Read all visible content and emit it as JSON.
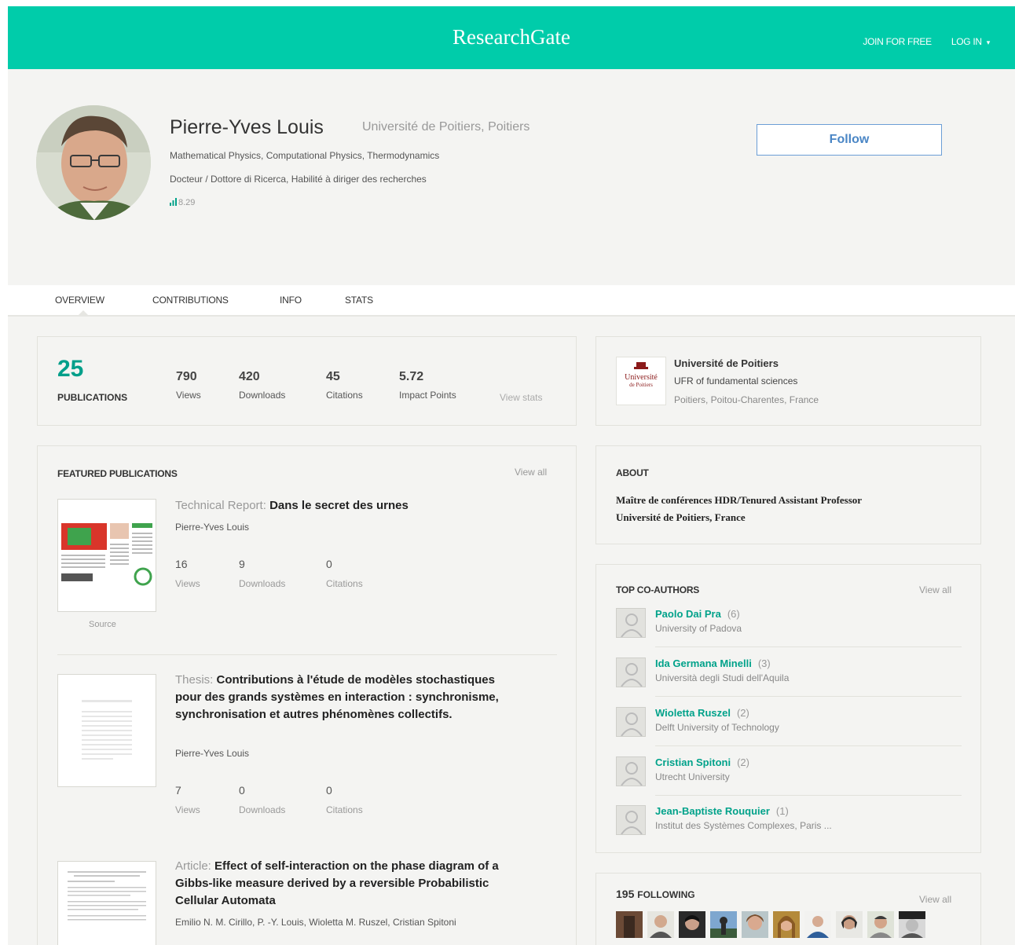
{
  "header": {
    "brand": "ResearchGate",
    "join_label": "JOIN FOR FREE",
    "login_label": "LOG IN",
    "login_caret": "▾",
    "color_accent": "#00ccaa"
  },
  "profile": {
    "name": "Pierre-Yves Louis",
    "institution": "Université de Poitiers, Poitiers",
    "topics": "Mathematical Physics, Computational Physics, Thermodynamics",
    "degree": "Docteur / Dottore di Ricerca, Habilité à diriger des recherches",
    "score": "8.29",
    "follow_label": "Follow"
  },
  "tabs": [
    "OVERVIEW",
    "CONTRIBUTIONS",
    "INFO",
    "STATS"
  ],
  "stats": {
    "publications": "25",
    "publications_label": "PUBLICATIONS",
    "items": [
      {
        "value": "790",
        "label": "Views"
      },
      {
        "value": "420",
        "label": "Downloads"
      },
      {
        "value": "45",
        "label": "Citations"
      },
      {
        "value": "5.72",
        "label": "Impact Points"
      }
    ],
    "view_stats": "View stats"
  },
  "featured": {
    "title": "FEATURED PUBLICATIONS",
    "view_all": "View all",
    "source_label": "Source",
    "pubs": [
      {
        "type": "Technical Report:",
        "title": "Dans le secret des urnes",
        "authors": "Pierre-Yves Louis",
        "stats": [
          {
            "value": "16",
            "label": "Views"
          },
          {
            "value": "9",
            "label": "Downloads"
          },
          {
            "value": "0",
            "label": "Citations"
          }
        ]
      },
      {
        "type": "Thesis:",
        "title": "Contributions à l'étude de modèles stochastiques pour des grands systèmes en interaction : synchronisme, synchronisation et autres phénomènes collectifs.",
        "authors": "Pierre-Yves Louis",
        "stats": [
          {
            "value": "7",
            "label": "Views"
          },
          {
            "value": "0",
            "label": "Downloads"
          },
          {
            "value": "0",
            "label": "Citations"
          }
        ]
      },
      {
        "type": "Article:",
        "title": "Effect of self-interaction on the phase diagram of a Gibbs-like measure derived by a reversible Probabilistic Cellular Automata",
        "authors": "Emilio N. M. Cirillo, P. -Y. Louis, Wioletta M. Ruszel, Cristian Spitoni"
      }
    ]
  },
  "institution": {
    "logo_text_1": "Université",
    "logo_text_2": "de Poitiers",
    "name": "Université de Poitiers",
    "dept": "UFR of fundamental sciences",
    "location": "Poitiers, Poitou-Charentes, France"
  },
  "about": {
    "title": "ABOUT",
    "line1": "Maître de conférences HDR/Tenured Assistant Professor",
    "line2": "Université de Poitiers, France"
  },
  "coauthors": {
    "title": "TOP CO-AUTHORS",
    "view_all": "View all",
    "items": [
      {
        "name": "Paolo Dai Pra",
        "count": "(6)",
        "inst": "University of Padova"
      },
      {
        "name": "Ida Germana Minelli",
        "count": "(3)",
        "inst": "Università degli Studi dell'Aquila"
      },
      {
        "name": "Wioletta Ruszel",
        "count": "(2)",
        "inst": "Delft University of Technology"
      },
      {
        "name": "Cristian Spitoni",
        "count": "(2)",
        "inst": "Utrecht University"
      },
      {
        "name": "Jean-Baptiste Rouquier",
        "count": "(1)",
        "inst": "Institut des Systèmes Complexes, Paris ..."
      }
    ]
  },
  "following": {
    "count": "195",
    "label": "FOLLOWING",
    "view_all": "View all"
  }
}
